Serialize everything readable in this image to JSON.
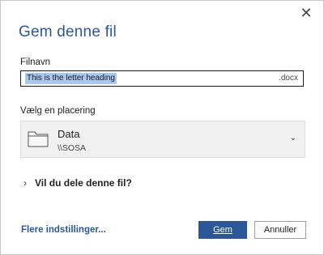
{
  "dialog": {
    "title": "Gem denne fil",
    "close_glyph": "✕"
  },
  "filename": {
    "label": "Filnavn",
    "value": "This is the letter heading",
    "extension": ".docx"
  },
  "location": {
    "label": "Vælg en placering",
    "name": "Data",
    "path": "\\\\SOSA",
    "icon": "folder-icon",
    "chevron": "⌄"
  },
  "share": {
    "chevron": "›",
    "label": "Vil du dele denne fil?"
  },
  "footer": {
    "more_options": "Flere indstillinger...",
    "save_label": "Gem",
    "cancel_label": "Annuller"
  },
  "colors": {
    "accent": "#2b579a",
    "selection": "#a8c8ee"
  }
}
